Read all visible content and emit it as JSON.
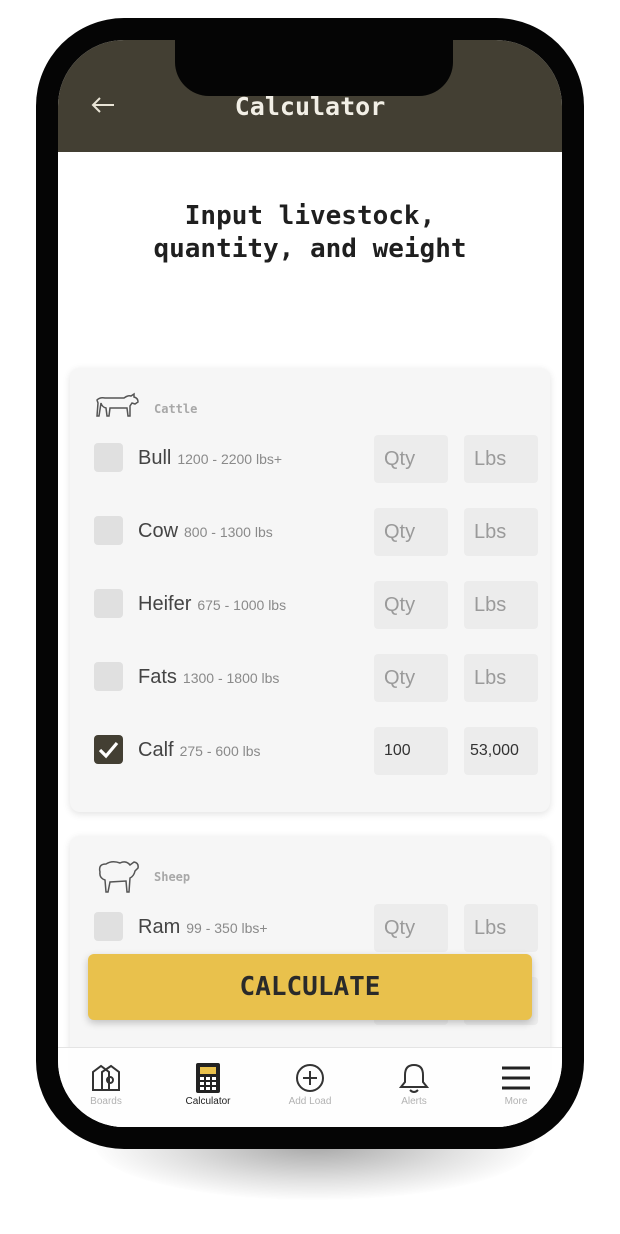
{
  "header": {
    "title": "Calculator",
    "back_icon": "arrow-left-icon"
  },
  "instruction": {
    "line1": "Input livestock,",
    "line2": "quantity, and weight"
  },
  "categories": [
    {
      "name": "Cattle",
      "icon": "cow-icon",
      "rows": [
        {
          "name": "Bull",
          "range": "1200 - 2200 lbs+",
          "checked": false,
          "qty_placeholder": "Qty",
          "lbs_placeholder": "Lbs",
          "qty": "",
          "lbs": ""
        },
        {
          "name": "Cow",
          "range": "800 - 1300 lbs",
          "checked": false,
          "qty_placeholder": "Qty",
          "lbs_placeholder": "Lbs",
          "qty": "",
          "lbs": ""
        },
        {
          "name": "Heifer",
          "range": "675 - 1000 lbs",
          "checked": false,
          "qty_placeholder": "Qty",
          "lbs_placeholder": "Lbs",
          "qty": "",
          "lbs": ""
        },
        {
          "name": "Fats",
          "range": "1300 - 1800 lbs",
          "checked": false,
          "qty_placeholder": "Qty",
          "lbs_placeholder": "Lbs",
          "qty": "",
          "lbs": ""
        },
        {
          "name": "Calf",
          "range": "275 - 600 lbs",
          "checked": true,
          "qty_placeholder": "Qty",
          "lbs_placeholder": "Lbs",
          "qty": "100",
          "lbs": "53,000"
        }
      ]
    },
    {
      "name": "Sheep",
      "icon": "sheep-icon",
      "rows": [
        {
          "name": "Ram",
          "range": "99 - 350 lbs+",
          "checked": false,
          "qty_placeholder": "Qty",
          "lbs_placeholder": "Lbs",
          "qty": "",
          "lbs": ""
        }
      ]
    }
  ],
  "calculate_button": {
    "label": "CALCULATE",
    "color": "#e9c14c"
  },
  "tabbar": {
    "items": [
      {
        "label": "Boards",
        "icon": "boards-icon",
        "active": false
      },
      {
        "label": "Calculator",
        "icon": "calculator-icon",
        "active": true
      },
      {
        "label": "Add Load",
        "icon": "add-circle-icon",
        "active": false
      },
      {
        "label": "Alerts",
        "icon": "bell-icon",
        "active": false
      },
      {
        "label": "More",
        "icon": "menu-icon",
        "active": false
      }
    ]
  },
  "colors": {
    "header_bg": "#433f33",
    "accent": "#e9c14c",
    "card_bg": "#f6f6f6"
  }
}
